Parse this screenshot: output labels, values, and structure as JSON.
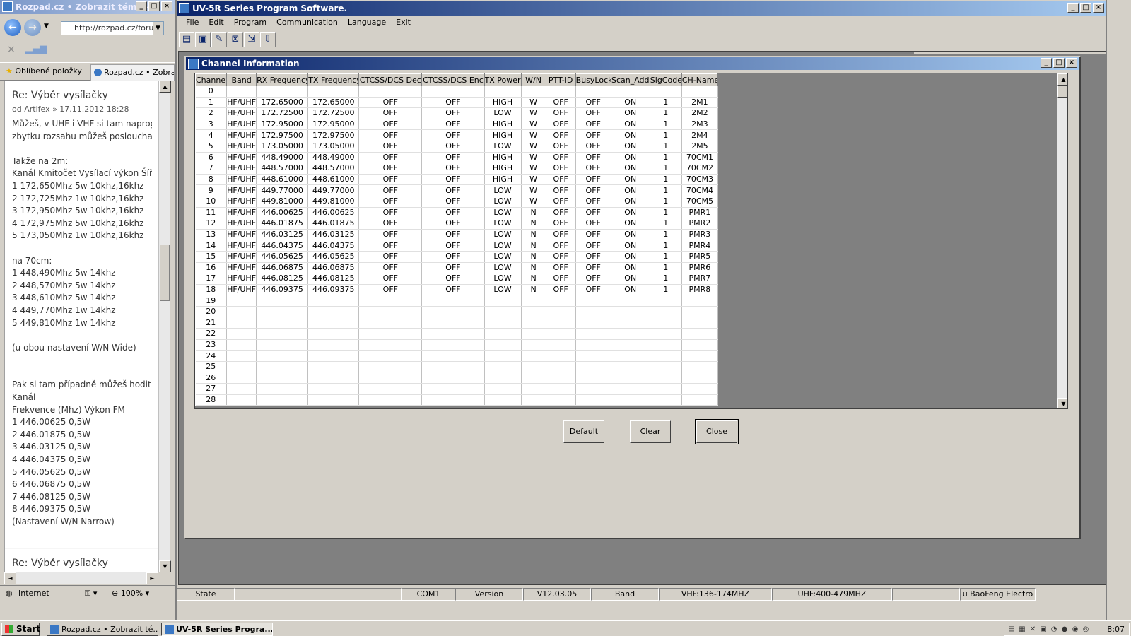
{
  "browser": {
    "title": "Rozpad.cz • Zobrazit téma -...",
    "address": "http://rozpad.cz/forum",
    "favorites_label": "Oblíbené položky",
    "tab_label": "Rozpad.cz • Zobrazit",
    "post1": {
      "title": "Re: Výběr vysílačky",
      "meta": "od Artifex » 17.11.2012 18:28",
      "body": "Můžeš, v UHF i VHF si tam naprogramovat\nzbytku rozsahu můžeš poslouchat\n\nTakže na 2m:\nKanál Kmitočet Vysílací výkon Šíře\n1 172,650Mhz 5w 10khz,16khz\n2 172,725Mhz 1w 10khz,16khz\n3 172,950Mhz 5w 10khz,16khz\n4 172,975Mhz 5w 10khz,16khz\n5 173,050Mhz 1w 10khz,16khz\n\nna 70cm:\n1 448,490Mhz 5w 14khz\n2 448,570Mhz 5w 14khz\n3 448,610Mhz 5w 14khz\n4 449,770Mhz 1w 14khz\n5 449,810Mhz 1w 14khz\n\n(u obou nastavení W/N Wide)\n\n\nPak si tam případně můžeš hodit\nKanál\nFrekvence (Mhz) Výkon FM\n1 446.00625 0,5W\n2 446.01875 0,5W\n3 446.03125 0,5W\n4 446.04375 0,5W\n5 446.05625 0,5W\n6 446.06875 0,5W\n7 446.08125 0,5W\n8 446.09375 0,5W\n(Nastavení W/N Narrow)"
    },
    "post2_title": "Re: Výběr vysílačky",
    "status_zone": "Internet",
    "zoom": "100%"
  },
  "app": {
    "title": "UV-5R Series Program Software.",
    "menu": [
      "File",
      "Edit",
      "Program",
      "Communication",
      "Language",
      "Exit"
    ],
    "toolbar_icons": [
      "read-icon",
      "save-icon",
      "open-icon",
      "write-icon",
      "download-icon",
      "upload-icon"
    ],
    "child_title": "Channel Information",
    "columns": [
      "Channel",
      "Band",
      "RX Frequency",
      "TX Frequency",
      "CTCSS/DCS Dec",
      "CTCSS/DCS Enc",
      "TX Power",
      "W/N",
      "PTT-ID",
      "BusyLock",
      "Scan_Add",
      "SigCode",
      "CH-Name"
    ],
    "rows": [
      [
        "0",
        "",
        "",
        "",
        "",
        "",
        "",
        "",
        "",
        "",
        "",
        "",
        ""
      ],
      [
        "1",
        "HF/UHF",
        "172.65000",
        "172.65000",
        "OFF",
        "OFF",
        "HIGH",
        "W",
        "OFF",
        "OFF",
        "ON",
        "1",
        "2M1"
      ],
      [
        "2",
        "HF/UHF",
        "172.72500",
        "172.72500",
        "OFF",
        "OFF",
        "LOW",
        "W",
        "OFF",
        "OFF",
        "ON",
        "1",
        "2M2"
      ],
      [
        "3",
        "HF/UHF",
        "172.95000",
        "172.95000",
        "OFF",
        "OFF",
        "HIGH",
        "W",
        "OFF",
        "OFF",
        "ON",
        "1",
        "2M3"
      ],
      [
        "4",
        "HF/UHF",
        "172.97500",
        "172.97500",
        "OFF",
        "OFF",
        "HIGH",
        "W",
        "OFF",
        "OFF",
        "ON",
        "1",
        "2M4"
      ],
      [
        "5",
        "HF/UHF",
        "173.05000",
        "173.05000",
        "OFF",
        "OFF",
        "LOW",
        "W",
        "OFF",
        "OFF",
        "ON",
        "1",
        "2M5"
      ],
      [
        "6",
        "HF/UHF",
        "448.49000",
        "448.49000",
        "OFF",
        "OFF",
        "HIGH",
        "W",
        "OFF",
        "OFF",
        "ON",
        "1",
        "70CM1"
      ],
      [
        "7",
        "HF/UHF",
        "448.57000",
        "448.57000",
        "OFF",
        "OFF",
        "HIGH",
        "W",
        "OFF",
        "OFF",
        "ON",
        "1",
        "70CM2"
      ],
      [
        "8",
        "HF/UHF",
        "448.61000",
        "448.61000",
        "OFF",
        "OFF",
        "HIGH",
        "W",
        "OFF",
        "OFF",
        "ON",
        "1",
        "70CM3"
      ],
      [
        "9",
        "HF/UHF",
        "449.77000",
        "449.77000",
        "OFF",
        "OFF",
        "LOW",
        "W",
        "OFF",
        "OFF",
        "ON",
        "1",
        "70CM4"
      ],
      [
        "10",
        "HF/UHF",
        "449.81000",
        "449.81000",
        "OFF",
        "OFF",
        "LOW",
        "W",
        "OFF",
        "OFF",
        "ON",
        "1",
        "70CM5"
      ],
      [
        "11",
        "HF/UHF",
        "446.00625",
        "446.00625",
        "OFF",
        "OFF",
        "LOW",
        "N",
        "OFF",
        "OFF",
        "ON",
        "1",
        "PMR1"
      ],
      [
        "12",
        "HF/UHF",
        "446.01875",
        "446.01875",
        "OFF",
        "OFF",
        "LOW",
        "N",
        "OFF",
        "OFF",
        "ON",
        "1",
        "PMR2"
      ],
      [
        "13",
        "HF/UHF",
        "446.03125",
        "446.03125",
        "OFF",
        "OFF",
        "LOW",
        "N",
        "OFF",
        "OFF",
        "ON",
        "1",
        "PMR3"
      ],
      [
        "14",
        "HF/UHF",
        "446.04375",
        "446.04375",
        "OFF",
        "OFF",
        "LOW",
        "N",
        "OFF",
        "OFF",
        "ON",
        "1",
        "PMR4"
      ],
      [
        "15",
        "HF/UHF",
        "446.05625",
        "446.05625",
        "OFF",
        "OFF",
        "LOW",
        "N",
        "OFF",
        "OFF",
        "ON",
        "1",
        "PMR5"
      ],
      [
        "16",
        "HF/UHF",
        "446.06875",
        "446.06875",
        "OFF",
        "OFF",
        "LOW",
        "N",
        "OFF",
        "OFF",
        "ON",
        "1",
        "PMR6"
      ],
      [
        "17",
        "HF/UHF",
        "446.08125",
        "446.08125",
        "OFF",
        "OFF",
        "LOW",
        "N",
        "OFF",
        "OFF",
        "ON",
        "1",
        "PMR7"
      ],
      [
        "18",
        "HF/UHF",
        "446.09375",
        "446.09375",
        "OFF",
        "OFF",
        "LOW",
        "N",
        "OFF",
        "OFF",
        "ON",
        "1",
        "PMR8"
      ],
      [
        "19",
        "",
        "",
        "",
        "",
        "",
        "",
        "",
        "",
        "",
        "",
        "",
        ""
      ],
      [
        "20",
        "",
        "",
        "",
        "",
        "",
        "",
        "",
        "",
        "",
        "",
        "",
        ""
      ],
      [
        "21",
        "",
        "",
        "",
        "",
        "",
        "",
        "",
        "",
        "",
        "",
        "",
        ""
      ],
      [
        "22",
        "",
        "",
        "",
        "",
        "",
        "",
        "",
        "",
        "",
        "",
        "",
        ""
      ],
      [
        "23",
        "",
        "",
        "",
        "",
        "",
        "",
        "",
        "",
        "",
        "",
        "",
        ""
      ],
      [
        "24",
        "",
        "",
        "",
        "",
        "",
        "",
        "",
        "",
        "",
        "",
        "",
        ""
      ],
      [
        "25",
        "",
        "",
        "",
        "",
        "",
        "",
        "",
        "",
        "",
        "",
        "",
        ""
      ],
      [
        "26",
        "",
        "",
        "",
        "",
        "",
        "",
        "",
        "",
        "",
        "",
        "",
        ""
      ],
      [
        "27",
        "",
        "",
        "",
        "",
        "",
        "",
        "",
        "",
        "",
        "",
        "",
        ""
      ],
      [
        "28",
        "",
        "",
        "",
        "",
        "",
        "",
        "",
        "",
        "",
        "",
        "",
        ""
      ]
    ],
    "buttons": {
      "default": "Default",
      "clear": "Clear",
      "close": "Close"
    },
    "status": {
      "state_label": "State",
      "state_value": "",
      "port": "COM1",
      "version_label": "Version",
      "version_value": "V12.03.05",
      "band_label": "Band",
      "vhf": "VHF:136-174MHZ",
      "uhf": "UHF:400-479MHZ",
      "vendor": "u BaoFeng Electro"
    }
  },
  "taskbar": {
    "start": "Start",
    "task1": "Rozpad.cz • Zobrazit té...",
    "task2": "UV-5R Series Progra...",
    "clock": "8:07"
  }
}
